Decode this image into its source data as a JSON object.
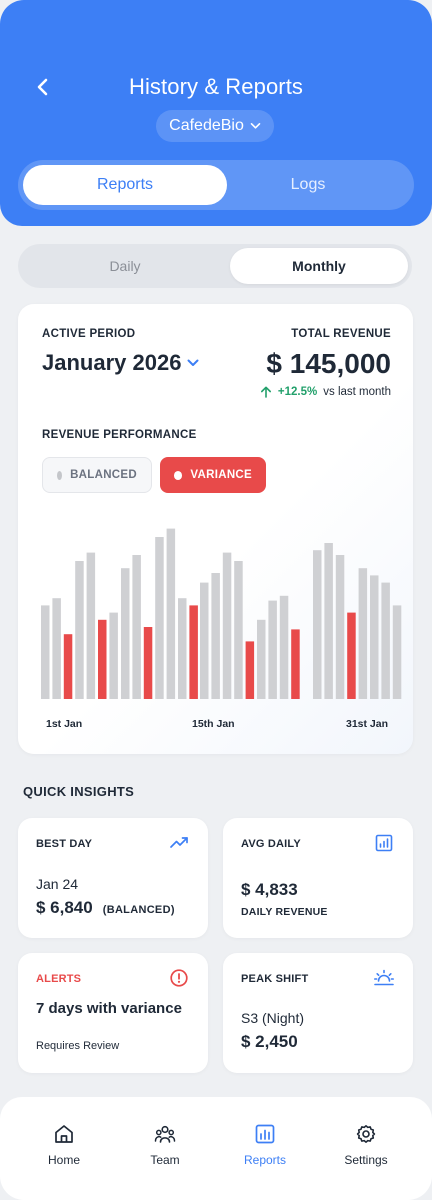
{
  "header": {
    "title": "History & Reports",
    "back_icon": "chevron-left-icon",
    "site": "CafedeBio",
    "tabs": [
      {
        "label": "Reports",
        "active": true
      },
      {
        "label": "Logs",
        "active": false
      }
    ],
    "color": "#3d7ff5"
  },
  "period_toggle": {
    "options": [
      {
        "label": "Daily",
        "active": false
      },
      {
        "label": "Monthly",
        "active": true
      }
    ]
  },
  "summary": {
    "active_period_label": "ACTIVE PERIOD",
    "active_period": "January 2026",
    "total_revenue_label": "TOTAL REVENUE",
    "total_revenue": "$ 145,000",
    "change": "+12.5%",
    "change_suffix": "vs last month",
    "change_color": "#22a06b"
  },
  "performance": {
    "label": "REVENUE PERFORMANCE",
    "legend": [
      {
        "label": "BALANCED",
        "color": "#c4c6ca",
        "active": false
      },
      {
        "label": "VARIANCE",
        "color": "#e84a4a",
        "active": true
      }
    ]
  },
  "chart_data": {
    "type": "bar",
    "categories": [
      "1",
      "2",
      "3",
      "4",
      "5",
      "6",
      "7",
      "8",
      "9",
      "10",
      "11",
      "12",
      "13",
      "14",
      "15",
      "16",
      "17",
      "18",
      "19",
      "20",
      "21",
      "22",
      "23",
      "24",
      "25",
      "26",
      "27",
      "28",
      "29",
      "30",
      "31"
    ],
    "x_tick_labels": [
      "1st Jan",
      "15th Jan",
      "31st Jan"
    ],
    "values": [
      78,
      84,
      54,
      115,
      122,
      66,
      72,
      109,
      120,
      60,
      135,
      142,
      84,
      78,
      97,
      105,
      122,
      115,
      48,
      66,
      82,
      86,
      58,
      124,
      130,
      120,
      72,
      109,
      103,
      97,
      78
    ],
    "status": [
      "balanced",
      "balanced",
      "variance",
      "balanced",
      "balanced",
      "variance",
      "balanced",
      "balanced",
      "balanced",
      "variance",
      "balanced",
      "balanced",
      "balanced",
      "variance",
      "balanced",
      "balanced",
      "balanced",
      "balanced",
      "variance",
      "balanced",
      "balanced",
      "balanced",
      "variance",
      "balanced",
      "balanced",
      "balanced",
      "variance",
      "balanced",
      "balanced",
      "balanced",
      "balanced"
    ],
    "colors": {
      "balanced": "#cfd0d3",
      "variance": "#e84a4a"
    },
    "ylim": [
      0,
      150
    ],
    "grid": false,
    "legend_position": "top-left"
  },
  "insights": {
    "title": "QUICK INSIGHTS",
    "best_day": {
      "label": "BEST DAY",
      "icon": "trending-up-icon",
      "date": "Jan 24",
      "value": "$ 6,840",
      "tag": "(BALANCED)"
    },
    "avg_daily": {
      "label": "AVG DAILY",
      "icon": "bar-chart-icon",
      "value": "$ 4,833",
      "sub": "DAILY REVENUE"
    },
    "alerts": {
      "label": "ALERTS",
      "icon": "alert-circle-icon",
      "main": "7 days with variance",
      "sub": "Requires Review",
      "color": "#e84a4a"
    },
    "peak_shift": {
      "label": "PEAK SHIFT",
      "icon": "sunrise-icon",
      "shift": "S3 (Night)",
      "value": "$ 2,450"
    }
  },
  "nav": [
    {
      "label": "Home",
      "icon": "home-icon",
      "active": false
    },
    {
      "label": "Team",
      "icon": "team-icon",
      "active": false
    },
    {
      "label": "Reports",
      "icon": "reports-icon",
      "active": true
    },
    {
      "label": "Settings",
      "icon": "gear-icon",
      "active": false
    }
  ]
}
